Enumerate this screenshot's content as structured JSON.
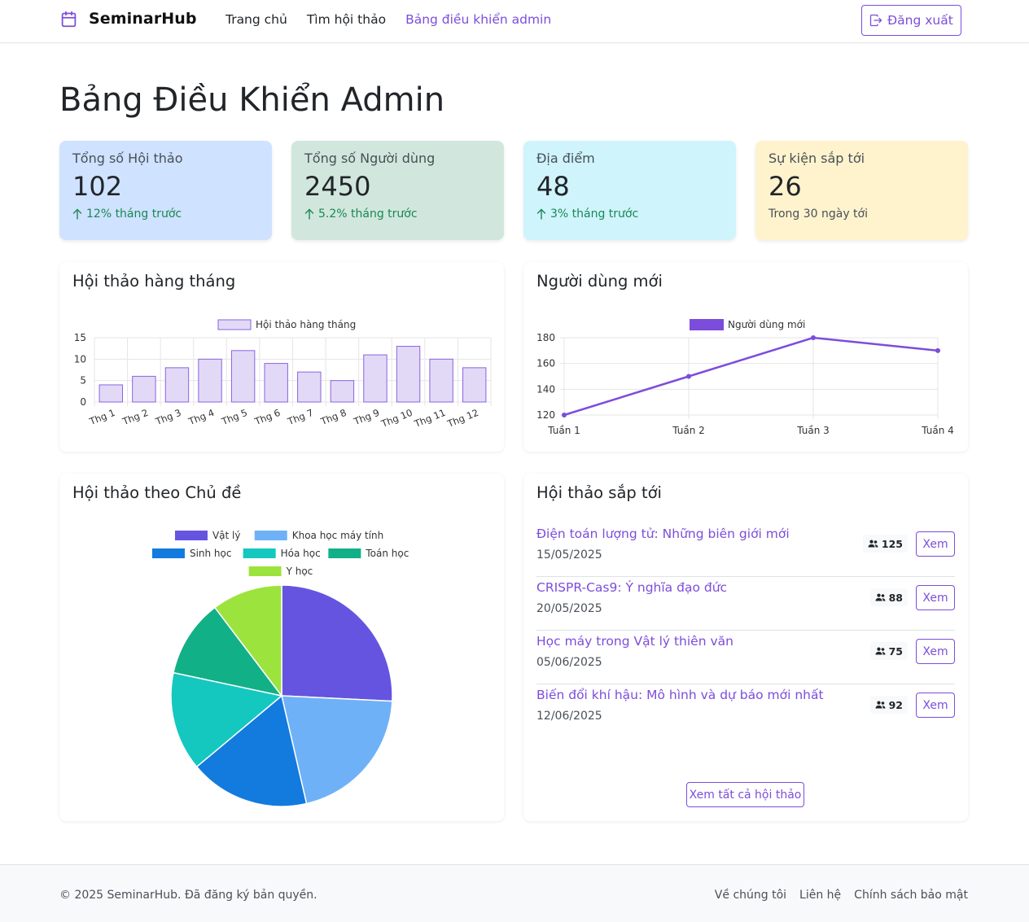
{
  "nav": {
    "brand": "SeminarHub",
    "links": [
      "Trang chủ",
      "Tìm hội thảo",
      "Bảng điều khiển admin"
    ],
    "active_index": 2,
    "logout": "Đăng xuất"
  },
  "page_title": "Bảng Điều Khiển Admin",
  "stats": [
    {
      "label": "Tổng số Hội thảo",
      "value": "102",
      "trend": "12% tháng trước",
      "bg": "#cfe2ff"
    },
    {
      "label": "Tổng số Người dùng",
      "value": "2450",
      "trend": "5.2% tháng trước",
      "bg": "#d1e7dd"
    },
    {
      "label": "Địa điểm",
      "value": "48",
      "trend": "3% tháng trước",
      "bg": "#cff4fc"
    },
    {
      "label": "Sự kiện sắp tới",
      "value": "26",
      "trend": "Trong 30 ngày tới",
      "bg": "#fff3cd"
    }
  ],
  "panels": {
    "monthly_title": "Hội thảo hàng tháng",
    "new_users_title": "Người dùng mới",
    "topics_title": "Hội thảo theo Chủ đề",
    "upcoming_title": "Hội thảo sắp tới"
  },
  "chart_data": [
    {
      "type": "bar",
      "legend": "Hội thảo hàng tháng",
      "categories": [
        "Thg 1",
        "Thg 2",
        "Thg 3",
        "Thg 4",
        "Thg 5",
        "Thg 6",
        "Thg 7",
        "Thg 8",
        "Thg 9",
        "Thg 10",
        "Thg 11",
        "Thg 12"
      ],
      "values": [
        4,
        6,
        8,
        10,
        12,
        9,
        7,
        5,
        11,
        13,
        10,
        8
      ],
      "ylim": [
        0,
        15
      ],
      "yticks": [
        0,
        5,
        10,
        15
      ],
      "grid": true,
      "fill": "#e2d9f7",
      "stroke": "#8a63e0"
    },
    {
      "type": "line",
      "legend": "Người dùng mới",
      "categories": [
        "Tuần 1",
        "Tuần 2",
        "Tuần 3",
        "Tuần 4"
      ],
      "values": [
        120,
        150,
        180,
        170
      ],
      "ylim": [
        120,
        180
      ],
      "yticks": [
        120,
        140,
        160,
        180
      ],
      "grid": true,
      "color": "#7c4ddb"
    },
    {
      "type": "pie",
      "labels": [
        "Vật lý",
        "Khoa học máy tính",
        "Sinh học",
        "Hóa học",
        "Toán học",
        "Y học"
      ],
      "values": [
        25,
        20,
        17,
        14,
        11,
        10
      ],
      "colors": [
        "#6554e0",
        "#6eb1f7",
        "#137ade",
        "#14c8c0",
        "#12b086",
        "#9de33e"
      ]
    }
  ],
  "upcoming": [
    {
      "title": "Điện toán lượng tử: Những biên giới mới",
      "date": "15/05/2025",
      "count": "125"
    },
    {
      "title": "CRISPR-Cas9: Ý nghĩa đạo đức",
      "date": "20/05/2025",
      "count": "88"
    },
    {
      "title": "Học máy trong Vật lý thiên văn",
      "date": "05/06/2025",
      "count": "75"
    },
    {
      "title": "Biến đổi khí hậu: Mô hình và dự báo mới nhất",
      "date": "12/06/2025",
      "count": "92"
    }
  ],
  "view_label": "Xem",
  "view_all": "Xem tất cả hội thảo",
  "footer": {
    "copyright": "© 2025 SeminarHub. Đã đăng ký bản quyền.",
    "links": [
      "Về chúng tôi",
      "Liên hệ",
      "Chính sách bảo mật"
    ]
  }
}
